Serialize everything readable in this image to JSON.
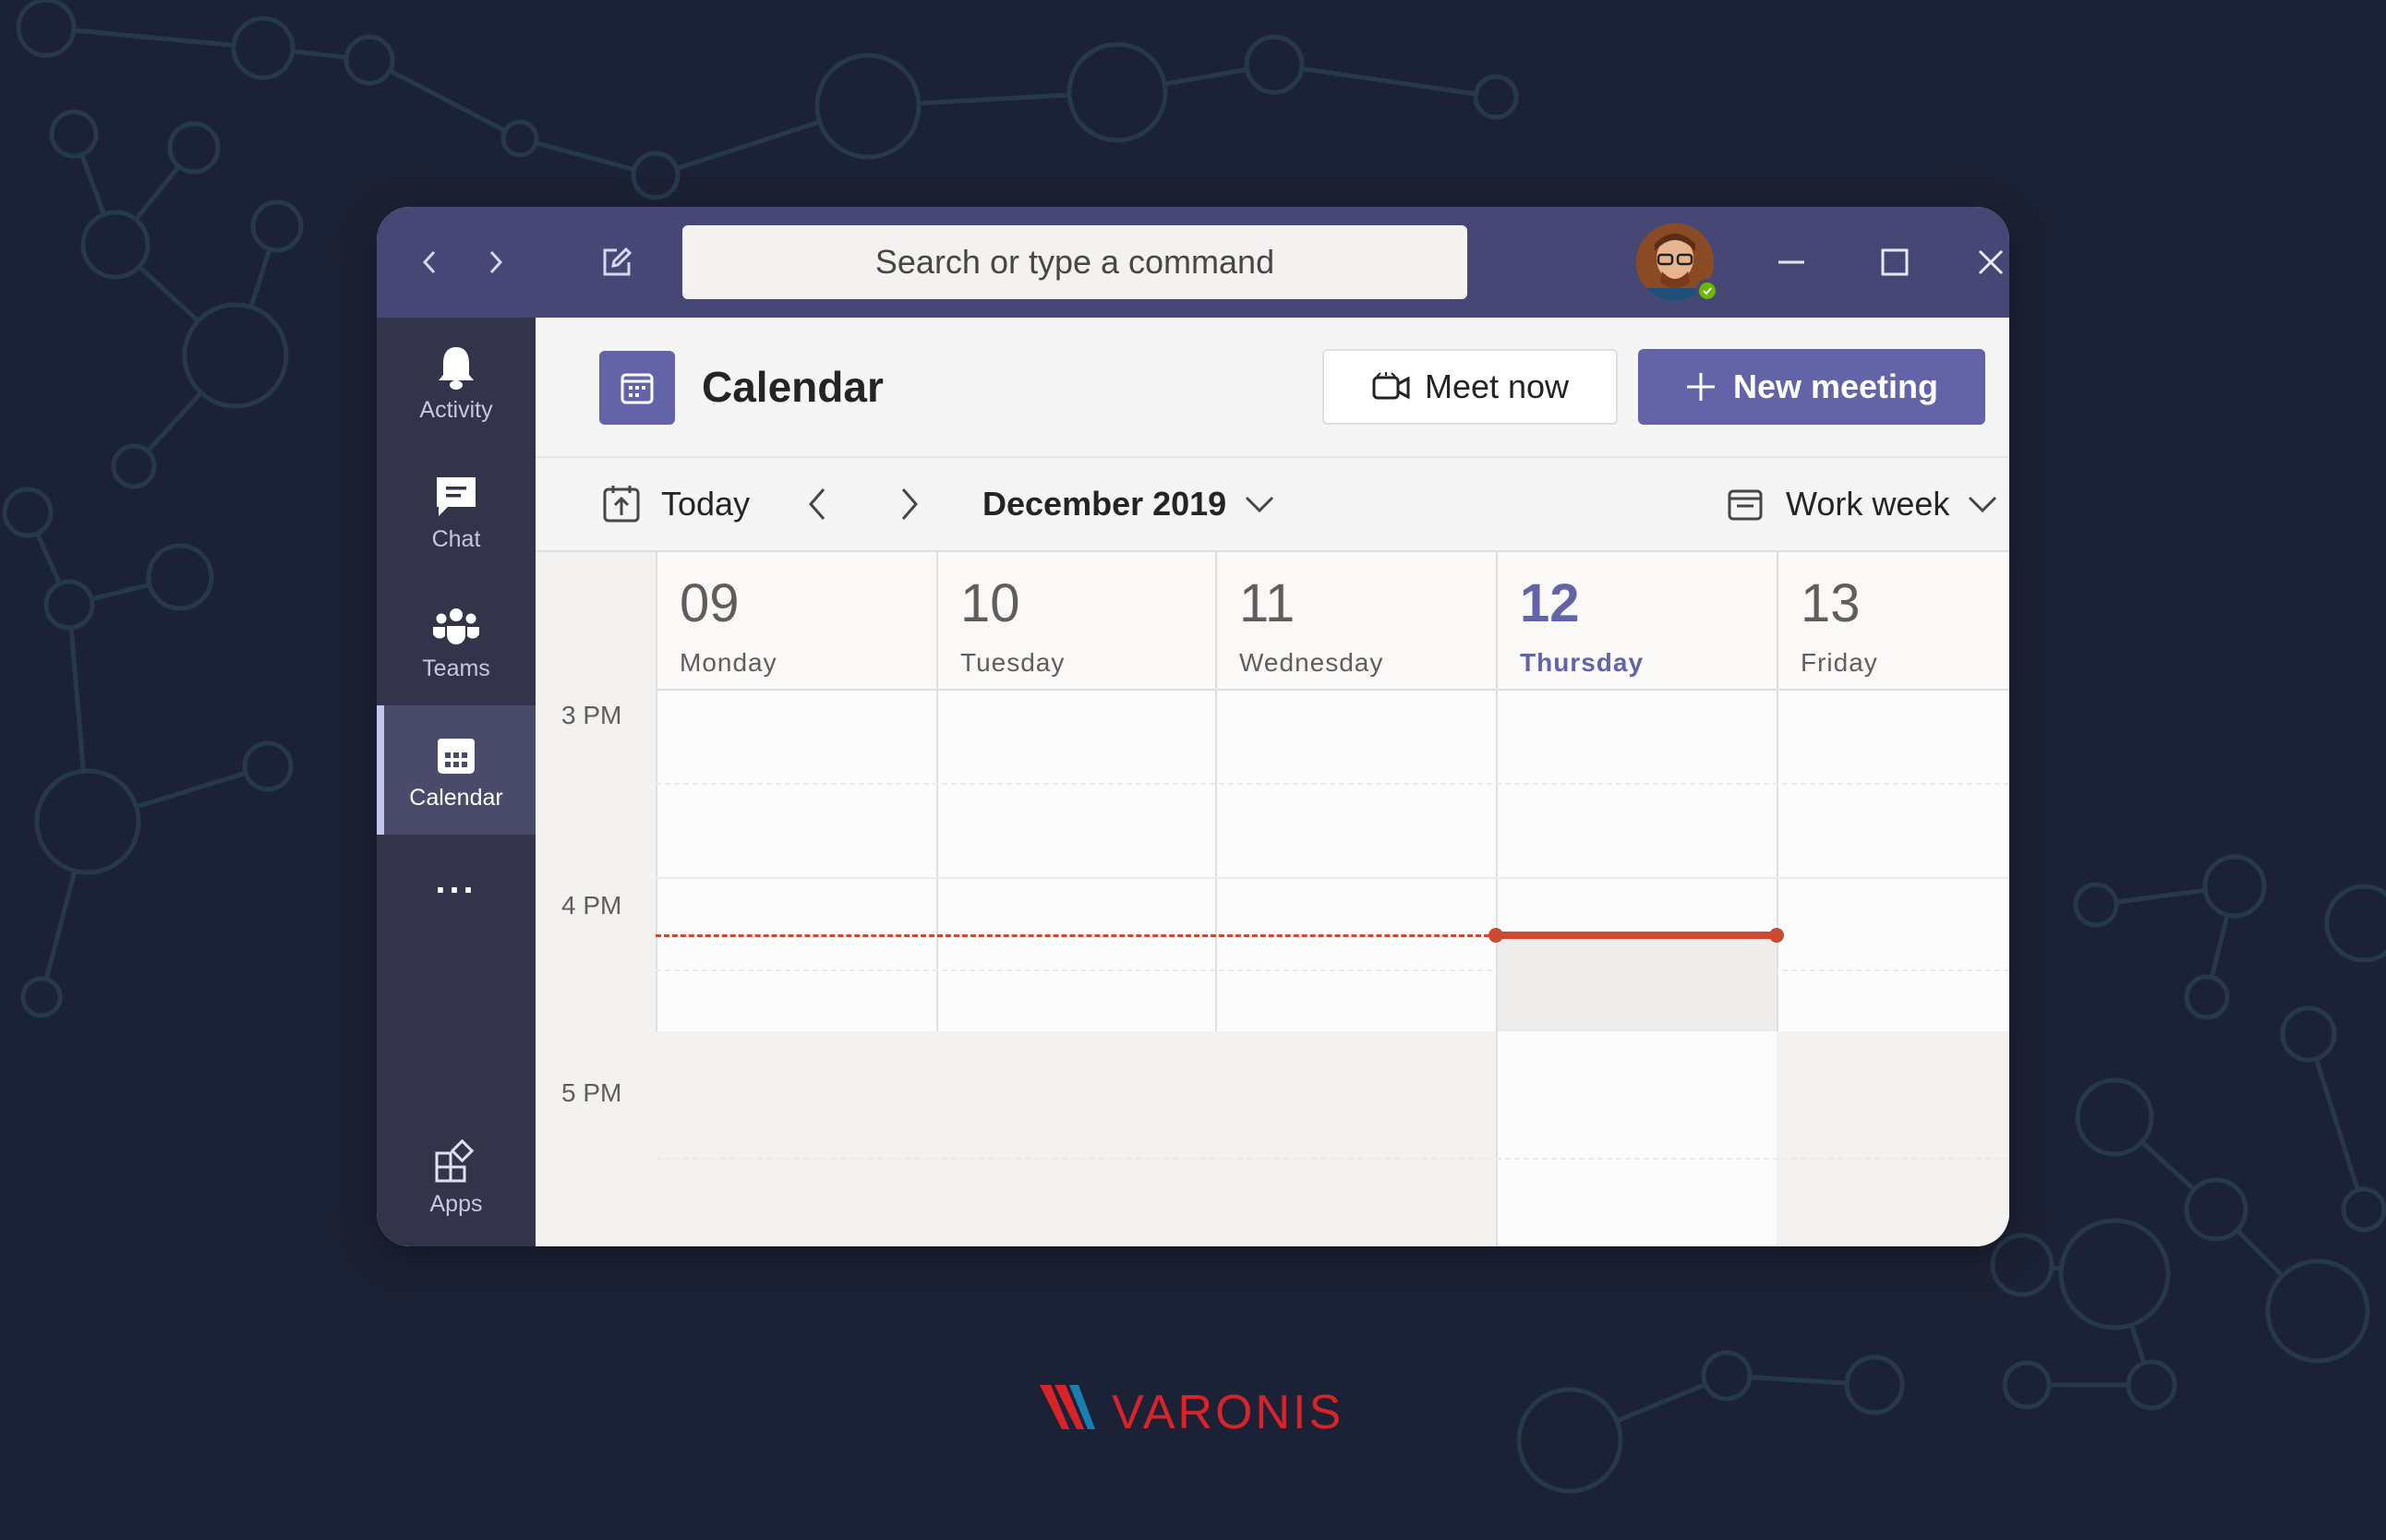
{
  "titlebar": {
    "search_placeholder": "Search or type a command",
    "back_icon": "chevron-left-icon",
    "forward_icon": "chevron-right-icon",
    "compose_icon": "compose-icon",
    "minimize_icon": "minimize-icon",
    "maximize_icon": "maximize-icon",
    "close_icon": "close-icon",
    "user_status": "available"
  },
  "rail": {
    "items": [
      {
        "label": "Activity",
        "icon": "bell-icon",
        "active": false
      },
      {
        "label": "Chat",
        "icon": "chat-icon",
        "active": false
      },
      {
        "label": "Teams",
        "icon": "teams-icon",
        "active": false
      },
      {
        "label": "Calendar",
        "icon": "calendar-icon",
        "active": true
      }
    ],
    "more_label": "...",
    "apps_label": "Apps"
  },
  "header": {
    "title": "Calendar",
    "meet_now_label": "Meet now",
    "new_meeting_label": "New meeting"
  },
  "toolbar": {
    "today_label": "Today",
    "month_label": "December 2019",
    "view_label": "Work week"
  },
  "days": [
    {
      "num": "09",
      "name": "Monday",
      "today": false
    },
    {
      "num": "10",
      "name": "Tuesday",
      "today": false
    },
    {
      "num": "11",
      "name": "Wednesday",
      "today": false
    },
    {
      "num": "12",
      "name": "Thursday",
      "today": true
    },
    {
      "num": "13",
      "name": "Friday",
      "today": false
    }
  ],
  "times": [
    "3 PM",
    "4 PM",
    "5 PM"
  ],
  "colors": {
    "brand": "#6264a7",
    "titlebar": "#464775",
    "rail": "#33344a",
    "now_indicator": "#cc4a31",
    "background": "#1c2235"
  },
  "footer": {
    "logo_text": "VARONIS"
  }
}
